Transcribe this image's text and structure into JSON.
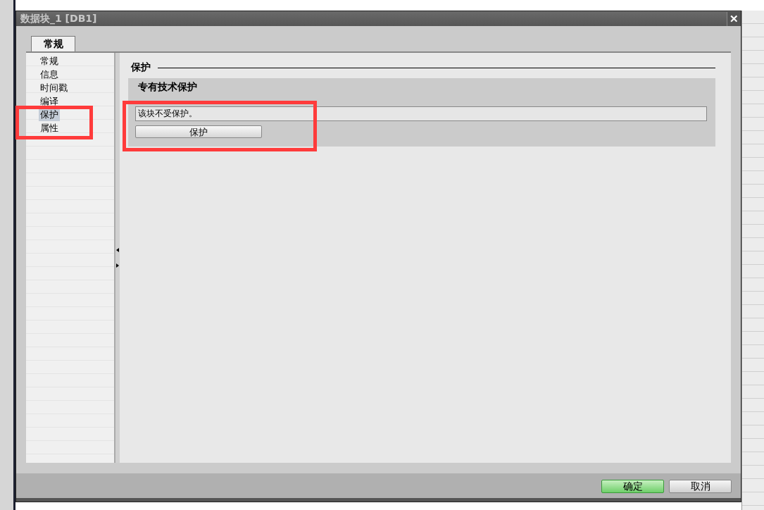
{
  "dialog": {
    "title": "数据块_1 [DB1]",
    "close_icon": "✕"
  },
  "tabs": [
    {
      "label": "常规",
      "selected": true
    }
  ],
  "nav": {
    "highlight_frame": true,
    "items": [
      {
        "label": "常规",
        "selected": false
      },
      {
        "label": "信息",
        "selected": false
      },
      {
        "label": "时间戳",
        "selected": false
      },
      {
        "label": "编译",
        "selected": false
      },
      {
        "label": "保护",
        "selected": true
      },
      {
        "label": "属性",
        "selected": false
      }
    ]
  },
  "content": {
    "heading": "保护",
    "section": {
      "title": "专有技术保护",
      "highlight_frame": true,
      "status": "该块不受保护。",
      "button": "保护"
    }
  },
  "buttons": [
    {
      "label": "确定",
      "kind": "primary"
    },
    {
      "label": "取消",
      "kind": "secondary"
    }
  ]
}
